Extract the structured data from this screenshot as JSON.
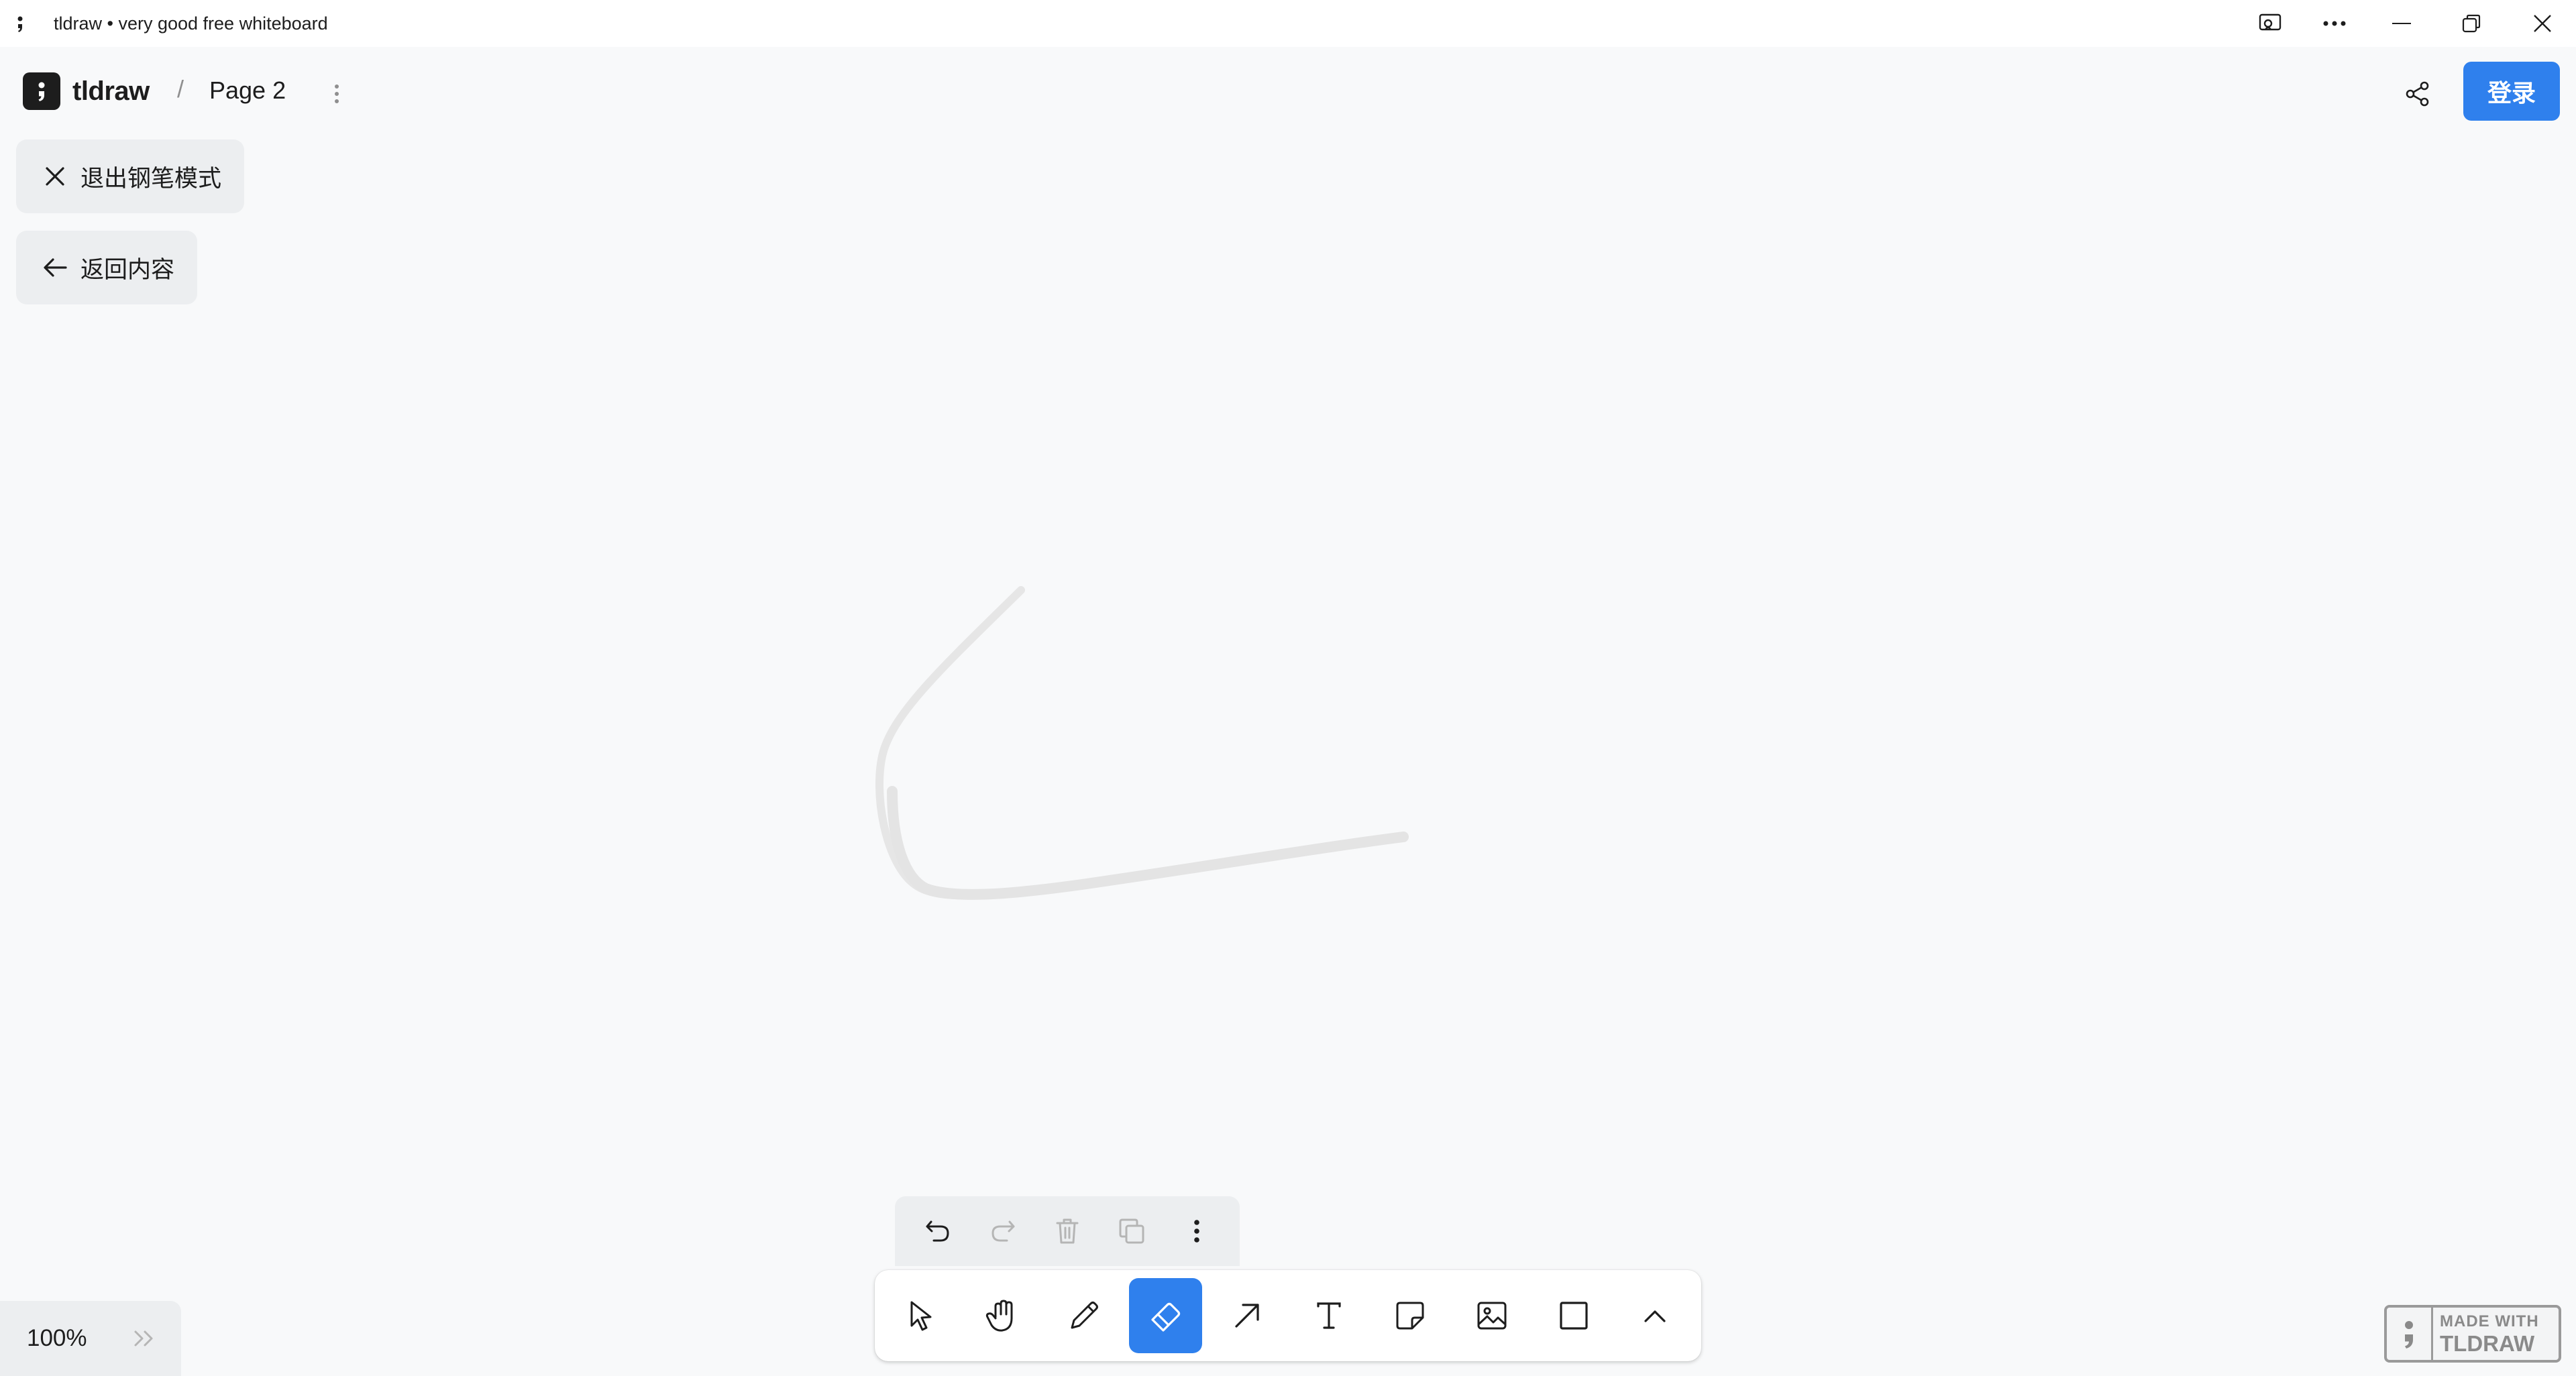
{
  "window": {
    "title": "tldraw • very good free whiteboard"
  },
  "header": {
    "logo_text": "tldraw",
    "breadcrumb_sep": "/",
    "page_name": "Page 2",
    "login_label": "登录"
  },
  "overlay": {
    "exit_pen_mode": "退出钢笔模式",
    "back_to_content": "返回内容"
  },
  "quick_actions": [
    "undo-icon",
    "redo-icon",
    "trash-icon",
    "duplicate-icon",
    "more-vertical-icon"
  ],
  "tools": [
    {
      "name": "select",
      "icon": "cursor-icon",
      "active": false
    },
    {
      "name": "hand",
      "icon": "hand-icon",
      "active": false
    },
    {
      "name": "draw",
      "icon": "pencil-icon",
      "active": false
    },
    {
      "name": "eraser",
      "icon": "eraser-icon",
      "active": true
    },
    {
      "name": "arrow",
      "icon": "arrow-icon",
      "active": false
    },
    {
      "name": "text",
      "icon": "text-icon",
      "active": false
    },
    {
      "name": "note",
      "icon": "sticky-note-icon",
      "active": false
    },
    {
      "name": "media",
      "icon": "image-icon",
      "active": false
    },
    {
      "name": "rectangle",
      "icon": "rectangle-icon",
      "active": false
    },
    {
      "name": "more",
      "icon": "chevron-up-icon",
      "active": false
    }
  ],
  "zoom": {
    "value": "100%"
  },
  "watermark": {
    "line1": "MADE WITH",
    "line2": "TLDRAW"
  },
  "colors": {
    "accent": "#2f80ed",
    "canvas": "#f8f9fa",
    "panel": "#eceef0",
    "stroke": "#e6e6e6"
  }
}
